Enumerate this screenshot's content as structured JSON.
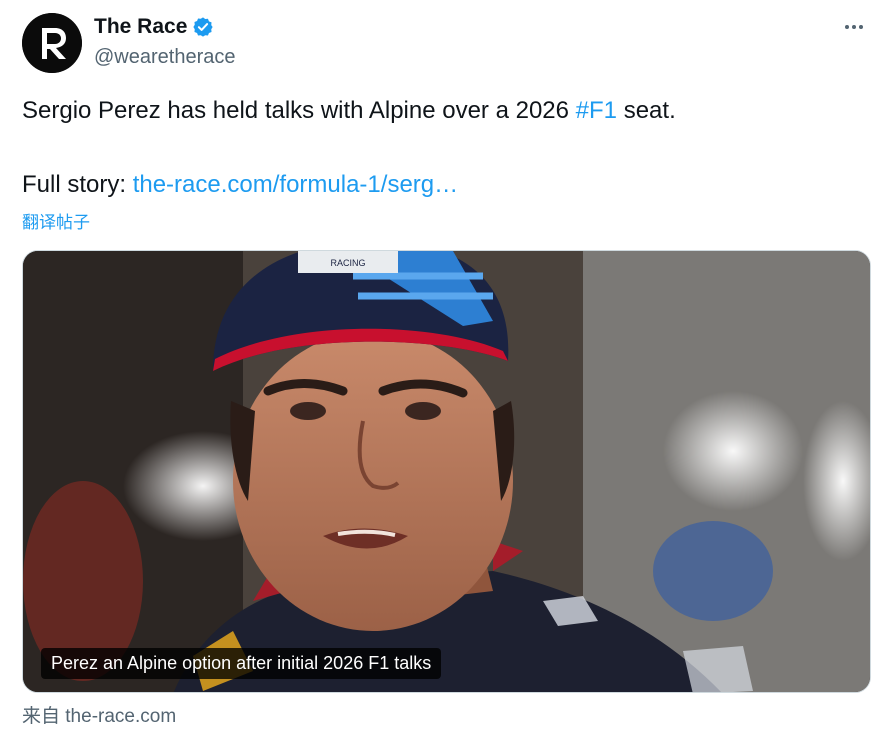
{
  "account": {
    "display_name": "The Race",
    "handle": "@wearetherace",
    "avatar_letter": "R",
    "verified": true
  },
  "tweet": {
    "line1_text": "Sergio Perez has held talks with Alpine over a 2026 ",
    "line1_hashtag": "#F1",
    "line1_tail": " seat.",
    "line2_label": "Full story: ",
    "line2_link": "the-race.com/formula-1/serg…",
    "translate_label": "翻译帖子"
  },
  "card": {
    "cap_text": "RACING",
    "caption": "Perez an Alpine option after initial 2026 F1 talks",
    "source": "来自 the-race.com"
  },
  "colors": {
    "accent": "#1d9bf0",
    "text": "#0f1419",
    "muted": "#536471"
  }
}
